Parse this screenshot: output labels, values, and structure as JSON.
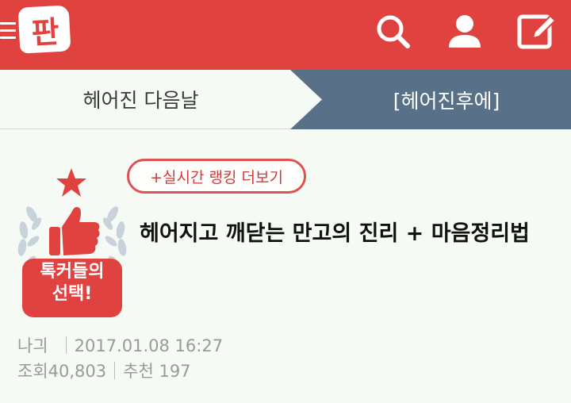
{
  "header": {
    "logo_text": "판",
    "menu_icon": "hamburger-menu-icon",
    "search_icon": "search-icon",
    "profile_icon": "user-icon",
    "write_icon": "edit-icon",
    "brand_color": "#e0423f"
  },
  "tabs": {
    "left_label": "헤어진 다음날",
    "right_label": "[헤어진후에]",
    "active_color": "#587088"
  },
  "badge": {
    "line1": "톡커들의",
    "line2": "선택!",
    "icon": "thumbs-up-laurel-icon"
  },
  "ranking_button": {
    "label": "+실시간 랭킹 더보기"
  },
  "post": {
    "title": "헤어지고 깨닫는 만고의 진리 + 마음정리법",
    "author": "나긔",
    "date": "2017.01.08 16:27",
    "views_label": "조회",
    "views": "40,803",
    "recommend_label": "추천",
    "recommends": "197"
  }
}
